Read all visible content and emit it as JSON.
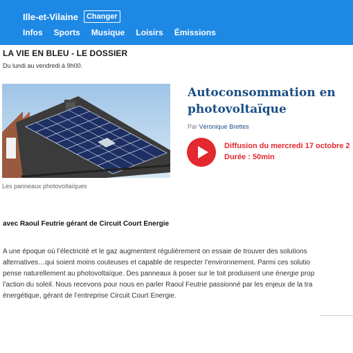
{
  "header": {
    "region": "Ille-et-Vilaine",
    "change_label": "Changer",
    "nav": [
      "Infos",
      "Sports",
      "Musique",
      "Loisirs",
      "Émissions"
    ]
  },
  "program": {
    "title": "LA VIE EN BLEU - LE DOSSIER",
    "schedule": "Du lundi au vendredi à 9h00."
  },
  "article": {
    "image_caption": "Les panneaux photovoltaïques",
    "headline": "Autoconsommation en photovoltaïque",
    "byline_prefix": "Par",
    "author": "Véronique Brettes",
    "broadcast": "Diffusion du mercredi 17 octobre 2",
    "duration": "Durée : 50min",
    "guest": "avec Raoul Feutrie gérant de Circuit Court Energie",
    "body_lines": [
      "A une époque où l’électricité et le gaz augmentent régulièrement on essaie de trouver des solutions",
      "alternatives…qui soient moins couteuses et capable de respecter l’environnement. Parmi ces solutio",
      "pense naturellement au photovoltaïque. Des panneaux à poser sur le toit produisent une énergie prop",
      "l’action du soleil. Nous recevons pour nous en parler Raoul Feutrie passionné par les enjeux de la tra",
      "énergétique, gérant de l’entreprise Circuit Court Energie."
    ]
  },
  "colors": {
    "brand_blue": "#1e88e5",
    "headline_blue": "#1b4f85",
    "accent_red": "#e3282f"
  },
  "icons": {
    "play": "play-icon"
  }
}
